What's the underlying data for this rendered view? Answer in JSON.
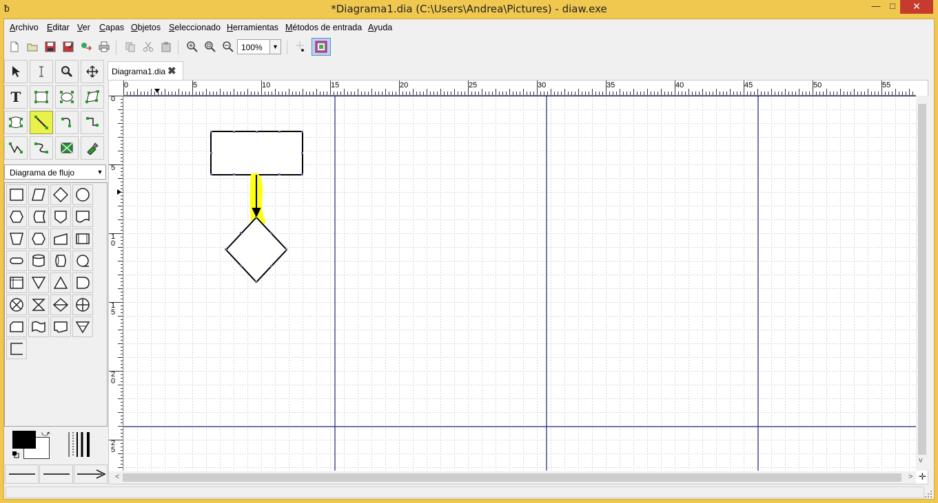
{
  "window": {
    "title": "*Diagrama1.dia (C:\\Users\\Andrea\\Pictures) - diaw.exe",
    "app_icon_glyph": "ƀ",
    "minimize_glyph": "—",
    "maximize_glyph": "□",
    "close_glyph": "✕"
  },
  "menubar": {
    "items": [
      "Archivo",
      "Editar",
      "Ver",
      "Capas",
      "Objetos",
      "Seleccionado",
      "Herramientas",
      "Métodos de entrada",
      "Ayuda"
    ]
  },
  "toolbar": {
    "zoom_value": "100%",
    "zoom_arrow": "▼",
    "icons": [
      "new-file-icon",
      "open-folder-icon",
      "save-icon",
      "save-as-icon",
      "export-icon",
      "print-icon",
      "copy-icon",
      "cut-icon",
      "paste-icon",
      "zoom-in-icon",
      "zoom-fit-icon",
      "zoom-out-icon",
      "snap-to-grid-icon",
      "snap-to-objects-icon"
    ]
  },
  "toolbox": {
    "tools": [
      "select-pointer-icon",
      "text-cursor-icon",
      "magnify-icon",
      "move-icon",
      "text-tool-icon",
      "box-tool-icon",
      "ellipse-tool-icon",
      "polygon-tool-icon",
      "beziergon-tool-icon",
      "line-tool-icon",
      "arc-tool-icon",
      "zigzag-tool-icon",
      "polyline-tool-icon",
      "bezier-tool-icon",
      "image-tool-icon",
      "outline-tool-icon"
    ],
    "active_tool": "line-tool-icon",
    "sheet_label": "Diagrama de flujo",
    "sheet_arrow": "▼",
    "shapes": [
      "process",
      "data",
      "decision",
      "connector",
      "preparation",
      "stored-data",
      "offpage",
      "document",
      "manual-operation",
      "terminal-hex",
      "manual-input",
      "predefined-process",
      "terminal",
      "disk",
      "direct-access",
      "sequential-access",
      "internal-storage",
      "extract",
      "merge",
      "delay",
      "summing-junction",
      "collate",
      "sort",
      "or",
      "card",
      "punched-tape",
      "display",
      "offline-storage",
      "annotation"
    ],
    "accent_color": "#eaf14a"
  },
  "document": {
    "tab_label": "Diagrama1.dia",
    "tab_close_glyph": "✖"
  },
  "rulers": {
    "h_labels": [
      "0",
      "5",
      "10",
      "15",
      "20",
      "25",
      "30",
      "35",
      "40",
      "45",
      "50",
      "55"
    ],
    "v_labels": [
      "0",
      "5",
      "1\n0",
      "1\n5",
      "2\n0",
      "2\n5"
    ]
  },
  "scroll": {
    "left_arrow": "<",
    "right_arrow": ">",
    "down_arrow": "v",
    "corner_glyph": "✛"
  }
}
